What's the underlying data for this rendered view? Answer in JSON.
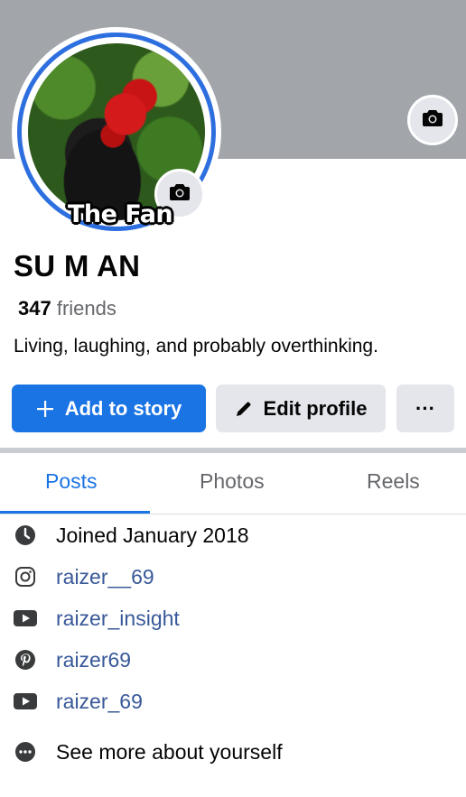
{
  "profile": {
    "sticker_text": "The Fan",
    "name": "SU M AN",
    "friends_count": "347",
    "friends_label": "friends",
    "bio": "Living, laughing, and probably overthinking."
  },
  "actions": {
    "add_story_label": "Add to story",
    "edit_profile_label": "Edit profile",
    "more_label": "···"
  },
  "tabs": [
    {
      "label": "Posts",
      "active": true
    },
    {
      "label": "Photos",
      "active": false
    },
    {
      "label": "Reels",
      "active": false
    }
  ],
  "details": [
    {
      "icon": "clock-icon",
      "text": "Joined January 2018",
      "link": false
    },
    {
      "icon": "instagram-icon",
      "text": "raizer__69",
      "link": true
    },
    {
      "icon": "youtube-icon",
      "text": "raizer_insight",
      "link": true
    },
    {
      "icon": "pinterest-icon",
      "text": "raizer69",
      "link": true
    },
    {
      "icon": "youtube-icon",
      "text": "raizer_69",
      "link": true
    },
    {
      "icon": "more-icon",
      "text": "See more about yourself",
      "link": false
    }
  ],
  "colors": {
    "accent": "#1b74e4",
    "cover": "#a2a5aa",
    "link": "#385898",
    "secondary_text": "#65676b",
    "button_gray": "#e4e6eb"
  }
}
